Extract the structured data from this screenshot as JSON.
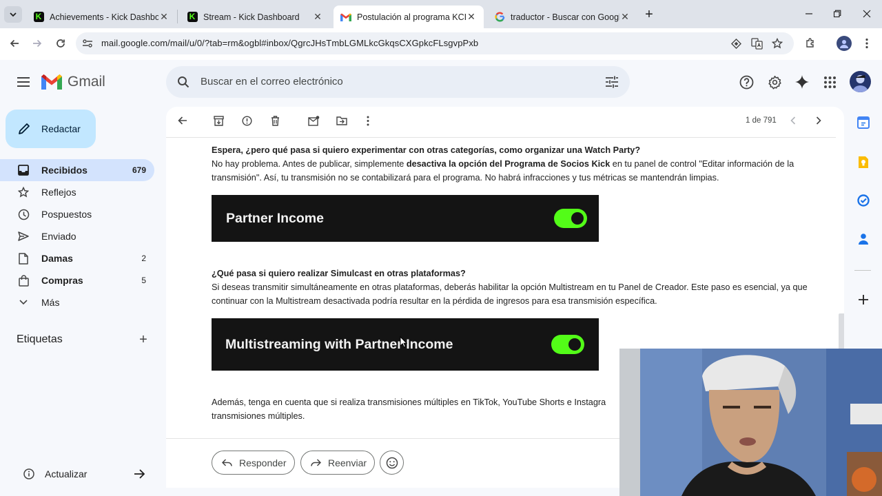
{
  "browser": {
    "tabs": [
      {
        "title": "Achievements - Kick Dashboard",
        "icon": "kick-icon"
      },
      {
        "title": "Stream - Kick Dashboard",
        "icon": "kick-icon"
      },
      {
        "title": "Postulación al programa KCIP -",
        "icon": "gmail-icon",
        "active": true
      },
      {
        "title": "traductor - Buscar con Google",
        "icon": "google-icon"
      }
    ],
    "url": "mail.google.com/mail/u/0/?tab=rm&ogbl#inbox/QgrcJHsTmbLGMLkcGkqsCXGpkcFLsgvpPxb"
  },
  "gmail": {
    "logo_text": "Gmail",
    "search_placeholder": "Buscar en el correo electrónico",
    "compose_label": "Redactar",
    "nav": [
      {
        "label": "Recibidos",
        "count": "679",
        "icon": "inbox-icon",
        "selected": true,
        "bold": true
      },
      {
        "label": "Reflejos",
        "count": "",
        "icon": "star-icon"
      },
      {
        "label": "Pospuestos",
        "count": "",
        "icon": "clock-icon"
      },
      {
        "label": "Enviado",
        "count": "",
        "icon": "send-icon"
      },
      {
        "label": "Damas",
        "count": "2",
        "icon": "document-icon",
        "bold": true
      },
      {
        "label": "Compras",
        "count": "5",
        "icon": "shopping-bag-icon",
        "bold": true
      },
      {
        "label": "Más",
        "count": "",
        "icon": "chevron-down-icon"
      }
    ],
    "labels_heading": "Etiquetas",
    "update_label": "Actualizar",
    "pagination": "1 de 791",
    "email": {
      "q1": "Espera, ¿pero qué pasa si quiero experimentar con otras categorías, como organizar una Watch Party?",
      "a1_pre": "No hay problema. Antes de publicar, simplemente ",
      "a1_bold": "desactiva la opción del Programa de Socios Kick",
      "a1_post": " en tu panel de control \"Editar información de la transmisión\". Así, tu transmisión no se contabilizará para el programa. No habrá infracciones y tus métricas se mantendrán limpias.",
      "banner1": "Partner Income",
      "q2": "¿Qué pasa si quiero realizar Simulcast en otras plataformas?",
      "a2": "Si deseas transmitir simultáneamente en otras plataformas, deberás habilitar la opción Multistream en tu Panel de Creador. Este paso es esencial, ya que continuar con la Multistream desactivada podría resultar en la pérdida de ingresos para esa transmisión específica.",
      "banner2": "Multistreaming with Partner Income",
      "a3": "Además, tenga en cuenta que si realiza transmisiones múltiples en TikTok, YouTube Shorts e Instagra",
      "a3b": "transmisiones múltiples."
    },
    "reply_label": "Responder",
    "forward_label": "Reenviar"
  },
  "colors": {
    "kick_green": "#53fc18",
    "selected_nav": "#d3e3fd",
    "compose_bg": "#c2e7ff"
  }
}
